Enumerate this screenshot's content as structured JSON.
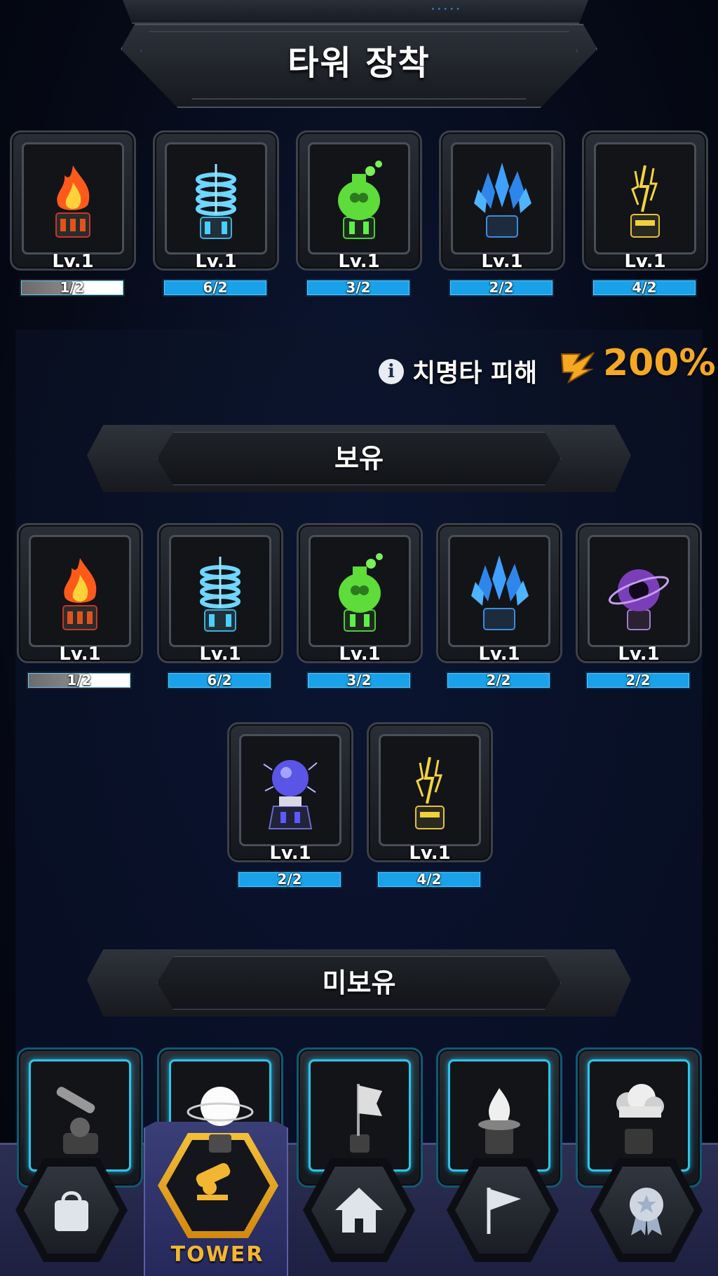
{
  "title": "타워 장착",
  "equipped": [
    {
      "icon": "fire-tower-icon",
      "level": "Lv.1",
      "count": "1/2",
      "progress": 0.5
    },
    {
      "icon": "tesla-coil-tower-icon",
      "level": "Lv.1",
      "count": "6/2",
      "progress": 1.0
    },
    {
      "icon": "poison-tower-icon",
      "level": "Lv.1",
      "count": "3/2",
      "progress": 1.0
    },
    {
      "icon": "ice-crystal-tower-icon",
      "level": "Lv.1",
      "count": "2/2",
      "progress": 1.0
    },
    {
      "icon": "lightning-tower-icon",
      "level": "Lv.1",
      "count": "4/2",
      "progress": 1.0
    }
  ],
  "crit": {
    "label": "치명타 피해",
    "value": "200%"
  },
  "sections": {
    "owned": "보유",
    "unowned": "미보유"
  },
  "owned": [
    {
      "icon": "fire-tower-icon",
      "level": "Lv.1",
      "count": "1/2",
      "progress": 0.5
    },
    {
      "icon": "tesla-coil-tower-icon",
      "level": "Lv.1",
      "count": "6/2",
      "progress": 1.0
    },
    {
      "icon": "poison-tower-icon",
      "level": "Lv.1",
      "count": "3/2",
      "progress": 1.0
    },
    {
      "icon": "ice-crystal-tower-icon",
      "level": "Lv.1",
      "count": "2/2",
      "progress": 1.0
    },
    {
      "icon": "black-hole-tower-icon",
      "level": "Lv.1",
      "count": "2/2",
      "progress": 1.0
    },
    {
      "icon": "plasma-orb-tower-icon",
      "level": "Lv.1",
      "count": "2/2",
      "progress": 1.0
    },
    {
      "icon": "lightning-tower-icon",
      "level": "Lv.1",
      "count": "4/2",
      "progress": 1.0
    }
  ],
  "unowned": [
    {
      "icon": "cannon-tower-icon"
    },
    {
      "icon": "moon-orb-tower-icon"
    },
    {
      "icon": "flag-tower-icon"
    },
    {
      "icon": "flame-brazier-tower-icon"
    },
    {
      "icon": "storm-cloud-tower-icon"
    }
  ],
  "nav": [
    {
      "name": "nav-shop",
      "icon": "bag-icon",
      "label": ""
    },
    {
      "name": "nav-tower",
      "icon": "cannon-icon",
      "label": "TOWER",
      "active": true
    },
    {
      "name": "nav-home",
      "icon": "home-icon",
      "label": ""
    },
    {
      "name": "nav-stage",
      "icon": "flag-icon",
      "label": ""
    },
    {
      "name": "nav-achievement",
      "icon": "medal-icon",
      "label": ""
    }
  ],
  "colors": {
    "accent": "#f4a823",
    "progress": "#19a2ea",
    "locked_frame": "#2ec5e8",
    "nav_active": "#f2b632"
  }
}
